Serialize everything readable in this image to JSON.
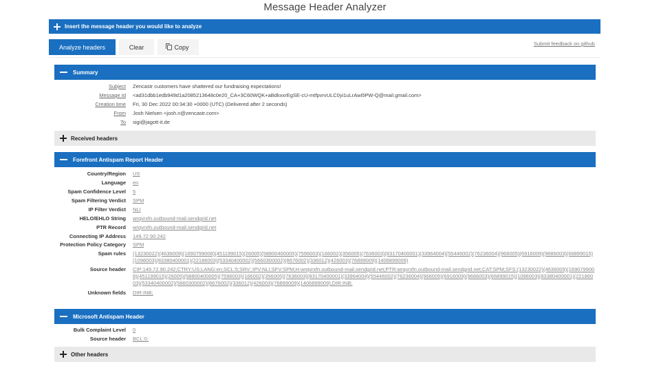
{
  "app": {
    "title": "Message Header Analyzer"
  },
  "insert_bar": {
    "label": "Insert the message header you would like to analyze",
    "icon": "plus-icon"
  },
  "toolbar": {
    "analyze_label": "Analyze headers",
    "clear_label": "Clear",
    "copy_label": "Copy",
    "copy_icon": "copy-icon",
    "feedback_link": "Submit feedback on github"
  },
  "colors": {
    "accent": "#1a6fc0",
    "collapsed_bg": "#e9e9ea"
  },
  "summary": {
    "title": "Summary",
    "expanded": true,
    "rows": [
      {
        "label": "Subject",
        "value": "Zencastr customers have shattered our fundraising expectations!"
      },
      {
        "label": "Message Id",
        "value": "<ad31dbb1edb949d1a2085213648c0e20_CA+3C60WQK+aBdkxxrEgSE-cU-mtfpvrvULC0yi1uLrAwi5PW-Q@mail.gmail.com>"
      },
      {
        "label": "Creation time",
        "value": "Fri, 30 Dec 2022 00:34:30 +0000 (UTC) (Delivered after 2 seconds)"
      },
      {
        "label": "From",
        "value": "Josh Nielsen <josh.n@zencastr.com>"
      },
      {
        "label": "To",
        "value": "sigi@jagott-it.de"
      }
    ]
  },
  "received_headers": {
    "title": "Received headers",
    "expanded": false
  },
  "forefront": {
    "title": "Forefront Antispam Report Header",
    "expanded": true,
    "rows": [
      {
        "label": "Country/Region",
        "value": "US"
      },
      {
        "label": "Language",
        "value": "en"
      },
      {
        "label": "Spam Confidence Level",
        "value": "5"
      },
      {
        "label": "Spam Filtering Verdict",
        "value": "SPM"
      },
      {
        "label": "IP Filter Verdict",
        "value": "NLI"
      },
      {
        "label": "HELO/EHLO String",
        "value": "wrqvrxfn.outbound-mail.sendgrid.net"
      },
      {
        "label": "PTR Record",
        "value": "wrqvrxfn.outbound-mail.sendgrid.net"
      },
      {
        "label": "Connecting IP Address",
        "value": "149.72.90.242"
      },
      {
        "label": "Protection Policy Category",
        "value": "SPM"
      },
      {
        "label": "Spam rules",
        "value": "(13230022)(4636009)(1690799008)(451199015)(26005)(58800400005)(7596003)(166002)(356005)(7636003)(83170400001)(33964004)(55446002)(76236004)(966005)(6916009)(9686003)(66899015)(1096003)(83380400001)(22186003)(53340400002)(5660300002)(8676002)(336012)(426003)(76899009)(1406899009)"
      },
      {
        "label": "Source header",
        "value": "CIP:149.72.90.242;CTRY:US;LANG:en;SCL:5;SRV:;IPV:NLI;SFV:SPM;H:wrqvrxfn.outbound-mail.sendgrid.net;PTR:wrqvrxfn.outbound-mail.sendgrid.net;CAT:SPM;SFS:(13230022)(4636009)(1690799008)(451199015)(26005)(58800400005)(7596003)(166002)(356005)(7636003)(83170400001)(33964004)(55446002)(76236004)(966005)(6916009)(9686003)(66899015)(1096003)(83380400001)(22186003)(53340400002)(5660300002)(8676002)(336012)(426003)(76899009)(1406899009);DIR:INB;"
      },
      {
        "label": "Unknown fields",
        "value": "DIR:INB;"
      }
    ]
  },
  "microsoft": {
    "title": "Microsoft Antispam Header",
    "expanded": true,
    "rows": [
      {
        "label": "Bulk Complaint Level",
        "value": "0"
      },
      {
        "label": "Source header",
        "value": "BCL:0;"
      }
    ]
  },
  "other_headers": {
    "title": "Other headers",
    "expanded": false
  }
}
